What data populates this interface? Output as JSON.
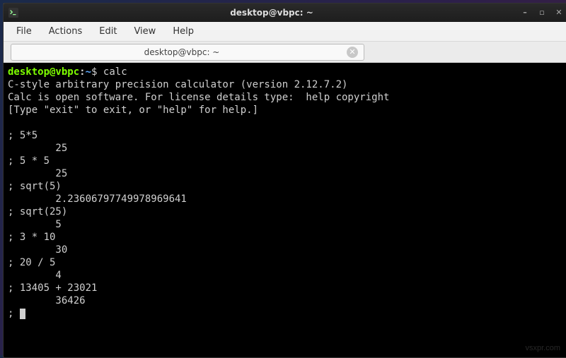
{
  "window": {
    "title": "desktop@vbpc: ~"
  },
  "menubar": {
    "file": "File",
    "actions": "Actions",
    "edit": "Edit",
    "view": "View",
    "help": "Help"
  },
  "tab": {
    "title": "desktop@vbpc: ~"
  },
  "prompt": {
    "userhost": "desktop@vbpc",
    "colon": ":",
    "path": "~",
    "symbol": "$"
  },
  "terminal": {
    "cmd1": "calc",
    "banner1": "C-style arbitrary precision calculator (version 2.12.7.2)",
    "banner2": "Calc is open software. For license details type:  help copyright",
    "banner3": "[Type \"exit\" to exit, or \"help\" for help.]",
    "blank": "",
    "p1_in": "; 5*5",
    "p1_out": "        25",
    "p2_in": "; 5 * 5",
    "p2_out": "        25",
    "p3_in": "; sqrt(5)",
    "p3_out": "        2.23606797749978969641",
    "p4_in": "; sqrt(25)",
    "p4_out": "        5",
    "p5_in": "; 3 * 10",
    "p5_out": "        30",
    "p6_in": "; 20 / 5",
    "p6_out": "        4",
    "p7_in": "; 13405 + 23021",
    "p7_out": "        36426",
    "cur_prompt": "; "
  },
  "watermark": "vsxpr.com"
}
